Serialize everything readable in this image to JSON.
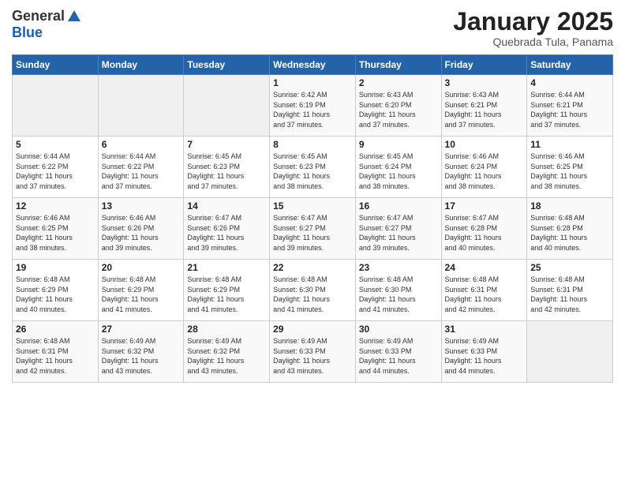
{
  "header": {
    "logo_general": "General",
    "logo_blue": "Blue",
    "month_title": "January 2025",
    "location": "Quebrada Tula, Panama"
  },
  "weekdays": [
    "Sunday",
    "Monday",
    "Tuesday",
    "Wednesday",
    "Thursday",
    "Friday",
    "Saturday"
  ],
  "weeks": [
    [
      {
        "day": "",
        "info": ""
      },
      {
        "day": "",
        "info": ""
      },
      {
        "day": "",
        "info": ""
      },
      {
        "day": "1",
        "info": "Sunrise: 6:42 AM\nSunset: 6:19 PM\nDaylight: 11 hours\nand 37 minutes."
      },
      {
        "day": "2",
        "info": "Sunrise: 6:43 AM\nSunset: 6:20 PM\nDaylight: 11 hours\nand 37 minutes."
      },
      {
        "day": "3",
        "info": "Sunrise: 6:43 AM\nSunset: 6:21 PM\nDaylight: 11 hours\nand 37 minutes."
      },
      {
        "day": "4",
        "info": "Sunrise: 6:44 AM\nSunset: 6:21 PM\nDaylight: 11 hours\nand 37 minutes."
      }
    ],
    [
      {
        "day": "5",
        "info": "Sunrise: 6:44 AM\nSunset: 6:22 PM\nDaylight: 11 hours\nand 37 minutes."
      },
      {
        "day": "6",
        "info": "Sunrise: 6:44 AM\nSunset: 6:22 PM\nDaylight: 11 hours\nand 37 minutes."
      },
      {
        "day": "7",
        "info": "Sunrise: 6:45 AM\nSunset: 6:23 PM\nDaylight: 11 hours\nand 37 minutes."
      },
      {
        "day": "8",
        "info": "Sunrise: 6:45 AM\nSunset: 6:23 PM\nDaylight: 11 hours\nand 38 minutes."
      },
      {
        "day": "9",
        "info": "Sunrise: 6:45 AM\nSunset: 6:24 PM\nDaylight: 11 hours\nand 38 minutes."
      },
      {
        "day": "10",
        "info": "Sunrise: 6:46 AM\nSunset: 6:24 PM\nDaylight: 11 hours\nand 38 minutes."
      },
      {
        "day": "11",
        "info": "Sunrise: 6:46 AM\nSunset: 6:25 PM\nDaylight: 11 hours\nand 38 minutes."
      }
    ],
    [
      {
        "day": "12",
        "info": "Sunrise: 6:46 AM\nSunset: 6:25 PM\nDaylight: 11 hours\nand 38 minutes."
      },
      {
        "day": "13",
        "info": "Sunrise: 6:46 AM\nSunset: 6:26 PM\nDaylight: 11 hours\nand 39 minutes."
      },
      {
        "day": "14",
        "info": "Sunrise: 6:47 AM\nSunset: 6:26 PM\nDaylight: 11 hours\nand 39 minutes."
      },
      {
        "day": "15",
        "info": "Sunrise: 6:47 AM\nSunset: 6:27 PM\nDaylight: 11 hours\nand 39 minutes."
      },
      {
        "day": "16",
        "info": "Sunrise: 6:47 AM\nSunset: 6:27 PM\nDaylight: 11 hours\nand 39 minutes."
      },
      {
        "day": "17",
        "info": "Sunrise: 6:47 AM\nSunset: 6:28 PM\nDaylight: 11 hours\nand 40 minutes."
      },
      {
        "day": "18",
        "info": "Sunrise: 6:48 AM\nSunset: 6:28 PM\nDaylight: 11 hours\nand 40 minutes."
      }
    ],
    [
      {
        "day": "19",
        "info": "Sunrise: 6:48 AM\nSunset: 6:29 PM\nDaylight: 11 hours\nand 40 minutes."
      },
      {
        "day": "20",
        "info": "Sunrise: 6:48 AM\nSunset: 6:29 PM\nDaylight: 11 hours\nand 41 minutes."
      },
      {
        "day": "21",
        "info": "Sunrise: 6:48 AM\nSunset: 6:29 PM\nDaylight: 11 hours\nand 41 minutes."
      },
      {
        "day": "22",
        "info": "Sunrise: 6:48 AM\nSunset: 6:30 PM\nDaylight: 11 hours\nand 41 minutes."
      },
      {
        "day": "23",
        "info": "Sunrise: 6:48 AM\nSunset: 6:30 PM\nDaylight: 11 hours\nand 41 minutes."
      },
      {
        "day": "24",
        "info": "Sunrise: 6:48 AM\nSunset: 6:31 PM\nDaylight: 11 hours\nand 42 minutes."
      },
      {
        "day": "25",
        "info": "Sunrise: 6:48 AM\nSunset: 6:31 PM\nDaylight: 11 hours\nand 42 minutes."
      }
    ],
    [
      {
        "day": "26",
        "info": "Sunrise: 6:48 AM\nSunset: 6:31 PM\nDaylight: 11 hours\nand 42 minutes."
      },
      {
        "day": "27",
        "info": "Sunrise: 6:49 AM\nSunset: 6:32 PM\nDaylight: 11 hours\nand 43 minutes."
      },
      {
        "day": "28",
        "info": "Sunrise: 6:49 AM\nSunset: 6:32 PM\nDaylight: 11 hours\nand 43 minutes."
      },
      {
        "day": "29",
        "info": "Sunrise: 6:49 AM\nSunset: 6:33 PM\nDaylight: 11 hours\nand 43 minutes."
      },
      {
        "day": "30",
        "info": "Sunrise: 6:49 AM\nSunset: 6:33 PM\nDaylight: 11 hours\nand 44 minutes."
      },
      {
        "day": "31",
        "info": "Sunrise: 6:49 AM\nSunset: 6:33 PM\nDaylight: 11 hours\nand 44 minutes."
      },
      {
        "day": "",
        "info": ""
      }
    ]
  ]
}
